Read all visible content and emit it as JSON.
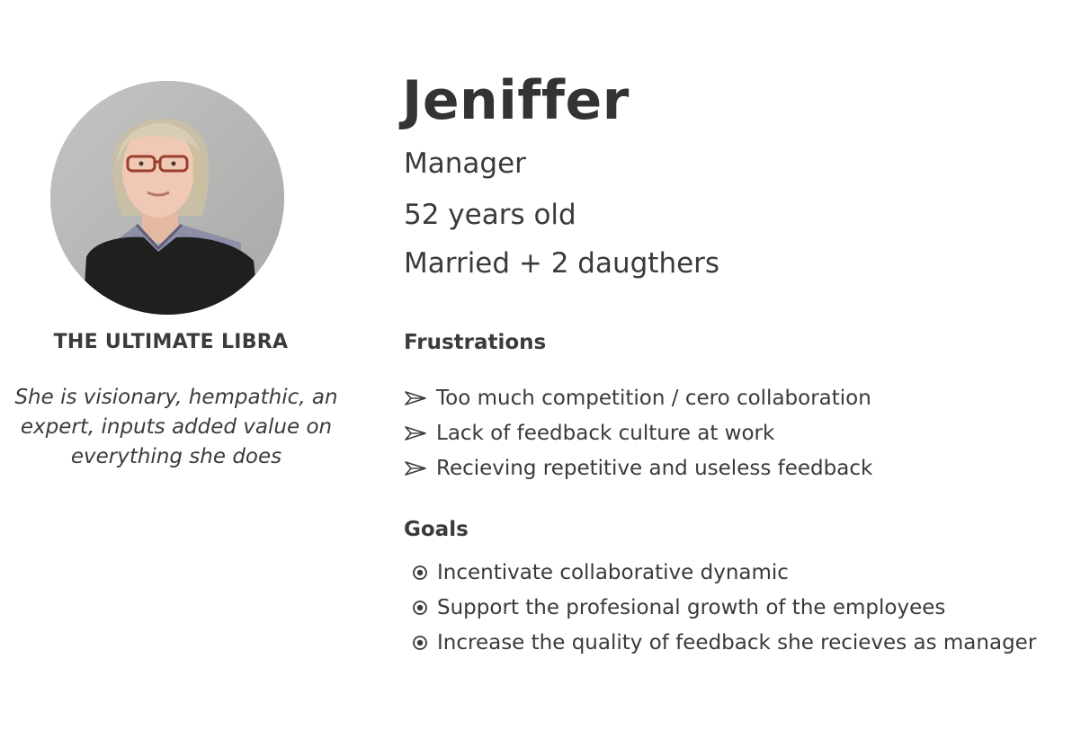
{
  "persona": {
    "name": "Jeniffer",
    "role": "Manager",
    "age": "52 years old",
    "family": "Married + 2 daugthers",
    "tagline": "THE ULTIMATE LIBRA",
    "quote": "She is visionary, hempathic, an expert, inputs added value on everything she does"
  },
  "frustrations": {
    "title": "Frustrations",
    "icon": "arrow-icon",
    "items": [
      "Too much competition / cero collaboration",
      "Lack of feedback culture at work",
      "Recieving repetitive and useless feedback"
    ]
  },
  "goals": {
    "title": "Goals",
    "icon": "radio-bullet-icon",
    "items": [
      "Incentivate collaborative dynamic",
      "Support the profesional growth of the employees",
      "Increase the quality of feedback she recieves as manager"
    ]
  },
  "colors": {
    "text": "#3a3a3a",
    "heading": "#333333",
    "background": "#ffffff"
  }
}
